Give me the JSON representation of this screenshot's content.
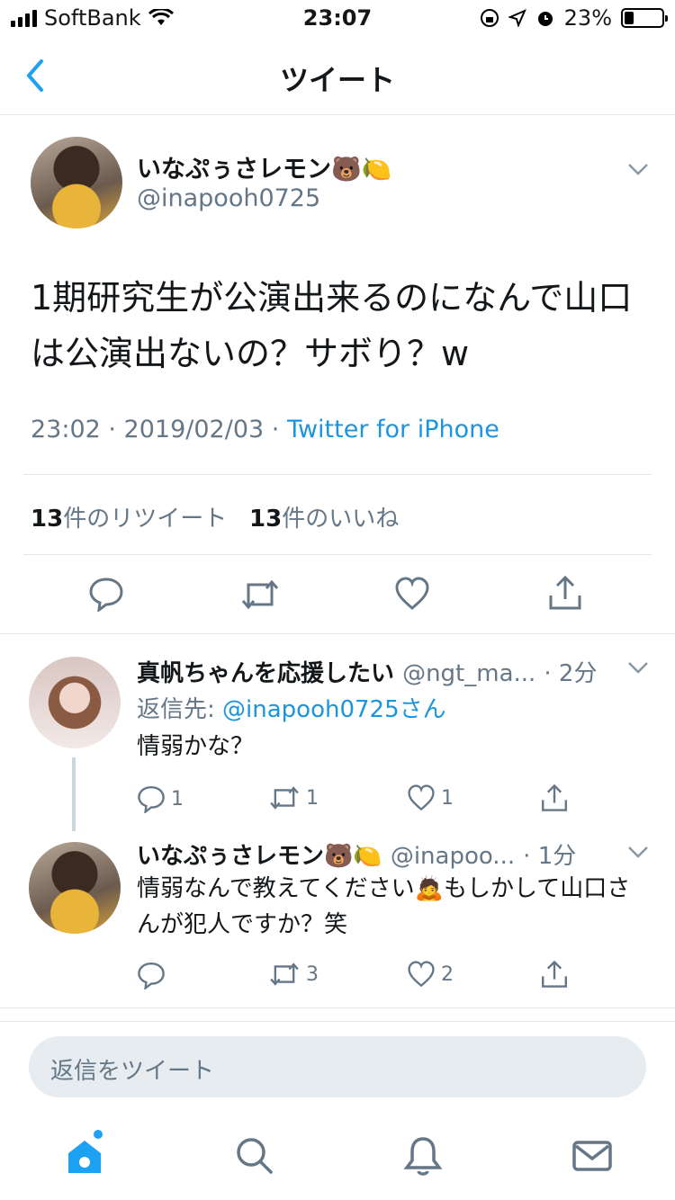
{
  "status": {
    "carrier": "SoftBank",
    "time": "23:07",
    "battery": "23%"
  },
  "nav": {
    "title": "ツイート"
  },
  "tweet": {
    "name": "いなぷぅさレモン🐻🍋",
    "handle": "@inapooh0725",
    "text": "1期研究生が公演出来るのになんで山口は公演出ないの？サボり？w",
    "time": "23:02 · 2019/02/03 · ",
    "source": "Twitter for iPhone",
    "retweet_count": "13",
    "retweet_label": "件のリツイート",
    "like_count": "13",
    "like_label": "件のいいね"
  },
  "replies": [
    {
      "name": "真帆ちゃんを応援したい",
      "handle": "@ngt_ma...",
      "time": "· 2分",
      "reply_to_label": "返信先: ",
      "reply_to_mention": "@inapooh0725さん",
      "text": "情弱かな？",
      "replies": "1",
      "retweets": "1",
      "likes": "1"
    },
    {
      "name": "いなぷぅさレモン🐻🍋",
      "handle": "@inapoo...",
      "time": "· 1分",
      "text": "情弱なんで教えてください🙇もしかして山口さんが犯人ですか？笑",
      "replies": "",
      "retweets": "3",
      "likes": "2"
    }
  ],
  "reply_box": {
    "placeholder": "返信をツイート"
  },
  "colors": {
    "accent": "#1da1f2",
    "secondary": "#657786"
  }
}
